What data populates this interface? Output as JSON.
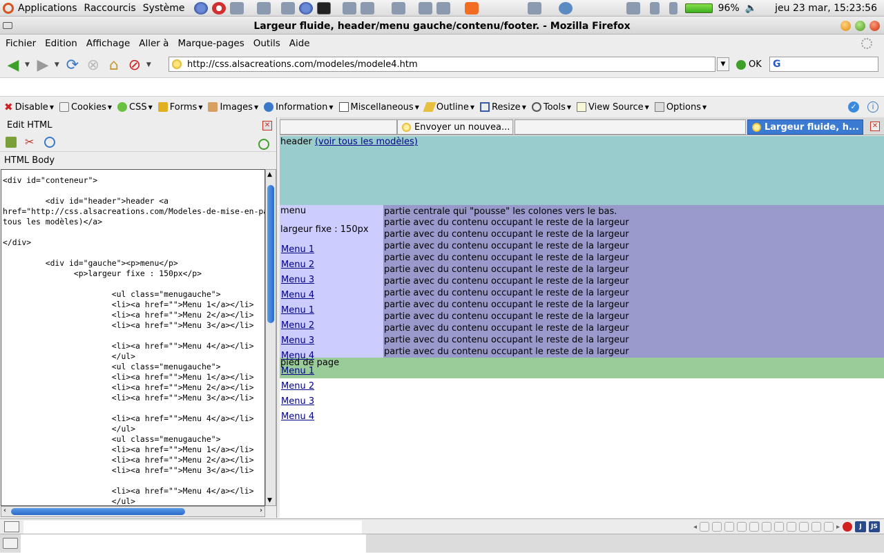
{
  "top_panel": {
    "applications": "Applications",
    "shortcuts": "Raccourcis",
    "system": "Système",
    "battery_percent": "96%",
    "clock": "jeu 23 mar, 15:23:56"
  },
  "window": {
    "title": "Largeur fluide, header/menu gauche/contenu/footer. - Mozilla Firefox"
  },
  "menubar": {
    "items": [
      "Fichier",
      "Edition",
      "Affichage",
      "Aller à",
      "Marque-pages",
      "Outils",
      "Aide"
    ]
  },
  "navbar": {
    "url": "http://css.alsacreations.com/modeles/modele4.htm",
    "ok_label": "OK"
  },
  "dev_toolbar": {
    "items": [
      "Disable",
      "Cookies",
      "CSS",
      "Forms",
      "Images",
      "Information",
      "Miscellaneous",
      "Outline",
      "Resize",
      "Tools",
      "View Source",
      "Options"
    ]
  },
  "edit_panel": {
    "title": "Edit HTML",
    "section": "HTML Body",
    "code": "<div id=\"conteneur\">\n\n         <div id=\"header\">header <a\nhref=\"http://css.alsacreations.com/Modeles-de-mise-en-page\">(voir\ntous les modèles)</a>\n\n</div>\n\n         <div id=\"gauche\"><p>menu</p>\n               <p>largeur fixe : 150px</p>\n\n                       <ul class=\"menugauche\">\n                       <li><a href=\"\">Menu 1</a></li>\n                       <li><a href=\"\">Menu 2</a></li>\n                       <li><a href=\"\">Menu 3</a></li>\n\n                       <li><a href=\"\">Menu 4</a></li>\n                       </ul>\n                       <ul class=\"menugauche\">\n                       <li><a href=\"\">Menu 1</a></li>\n                       <li><a href=\"\">Menu 2</a></li>\n                       <li><a href=\"\">Menu 3</a></li>\n\n                       <li><a href=\"\">Menu 4</a></li>\n                       </ul>\n                       <ul class=\"menugauche\">\n                       <li><a href=\"\">Menu 1</a></li>\n                       <li><a href=\"\">Menu 2</a></li>\n                       <li><a href=\"\">Menu 3</a></li>\n\n                       <li><a href=\"\">Menu 4</a></li>\n                       </ul>"
  },
  "tabs": {
    "tab2": "Envoyer un nouvea...",
    "tab4": "Largeur fluide, h..."
  },
  "page": {
    "header_text": "header",
    "header_link": "(voir tous les modèles)",
    "left_title": "menu",
    "left_width": "largeur fixe : 150px",
    "menu_items": [
      "Menu 1",
      "Menu 2",
      "Menu 3",
      "Menu 4",
      "Menu 1",
      "Menu 2",
      "Menu 3",
      "Menu 4",
      "Menu 1",
      "Menu 2",
      "Menu 3",
      "Menu 4"
    ],
    "center_first": "partie centrale qui \"pousse\" les colones vers le bas.",
    "center_line": "partie avec du contenu occupant le reste de la largeur",
    "center_line_count": 12,
    "footer": "pied de page"
  }
}
